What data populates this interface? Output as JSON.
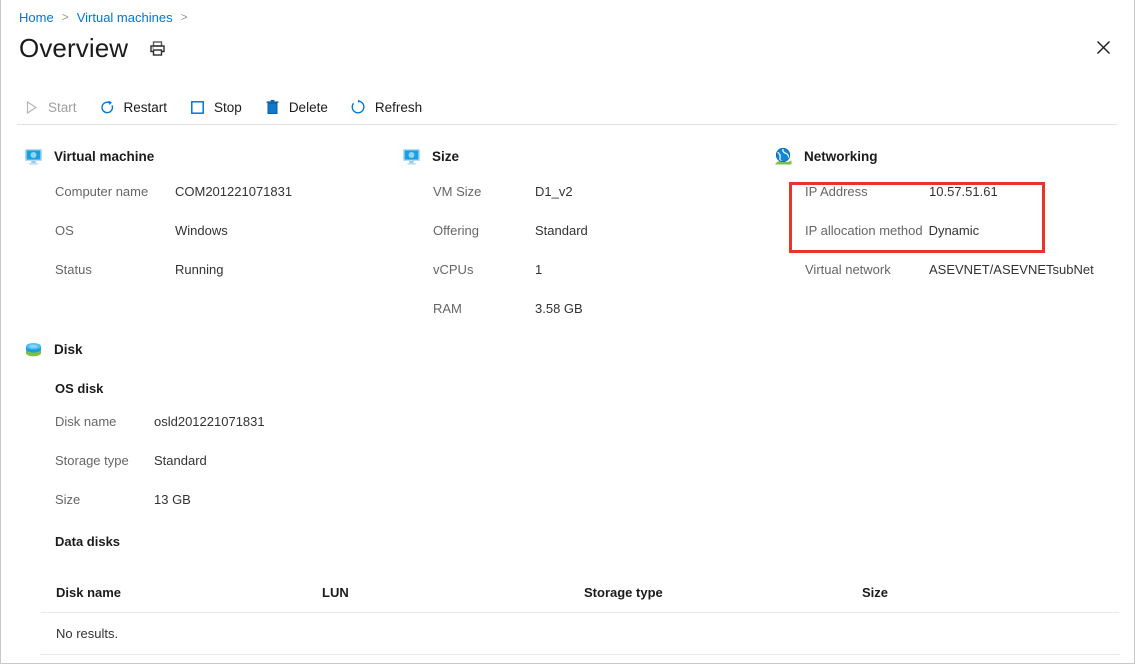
{
  "breadcrumb": {
    "items": [
      {
        "label": "Home",
        "link": true
      },
      {
        "label": "Virtual machines",
        "link": true
      }
    ],
    "separator": ">"
  },
  "header": {
    "title": "Overview",
    "print_icon": "print-icon",
    "close_icon": "close-icon"
  },
  "toolbar": {
    "items": [
      {
        "label": "Start",
        "icon": "play-icon",
        "disabled": true
      },
      {
        "label": "Restart",
        "icon": "restart-icon",
        "disabled": false
      },
      {
        "label": "Stop",
        "icon": "stop-icon",
        "disabled": false
      },
      {
        "label": "Delete",
        "icon": "trash-icon",
        "disabled": false
      },
      {
        "label": "Refresh",
        "icon": "refresh-icon",
        "disabled": false
      }
    ]
  },
  "sections": {
    "virtual_machine": {
      "title": "Virtual machine",
      "icon": "virtual-machine-icon",
      "rows": [
        {
          "label": "Computer name",
          "value": "COM201221071831"
        },
        {
          "label": "OS",
          "value": "Windows"
        },
        {
          "label": "Status",
          "value": "Running"
        }
      ]
    },
    "size": {
      "title": "Size",
      "icon": "size-icon",
      "rows": [
        {
          "label": "VM Size",
          "value": "D1_v2"
        },
        {
          "label": "Offering",
          "value": "Standard"
        },
        {
          "label": "vCPUs",
          "value": "1"
        },
        {
          "label": "RAM",
          "value": "3.58 GB"
        }
      ]
    },
    "networking": {
      "title": "Networking",
      "icon": "networking-icon",
      "rows": [
        {
          "label": "IP Address",
          "value": "10.57.51.61"
        },
        {
          "label": "IP allocation method",
          "value": "Dynamic"
        },
        {
          "label": "Virtual network",
          "value": "ASEVNET/ASEVNETsubNet"
        }
      ]
    },
    "disk": {
      "title": "Disk",
      "icon": "disk-icon",
      "os_disk_heading": "OS disk",
      "os_disk_rows": [
        {
          "label": "Disk name",
          "value": "osld201221071831"
        },
        {
          "label": "Storage type",
          "value": "Standard"
        },
        {
          "label": "Size",
          "value": "13 GB"
        }
      ],
      "data_disks_heading": "Data disks",
      "data_disks_table": {
        "columns": [
          "Disk name",
          "LUN",
          "Storage type",
          "Size"
        ],
        "rows": [],
        "empty_message": "No results."
      }
    }
  },
  "annotation": {
    "highlight_color": "#e8352b",
    "highlighted_rows": [
      "IP Address",
      "IP allocation method"
    ]
  },
  "colors": {
    "link": "#0078d4",
    "accent": "#0078d4",
    "label": "#666666",
    "value": "#333333",
    "disabled": "#a0a0a0"
  }
}
